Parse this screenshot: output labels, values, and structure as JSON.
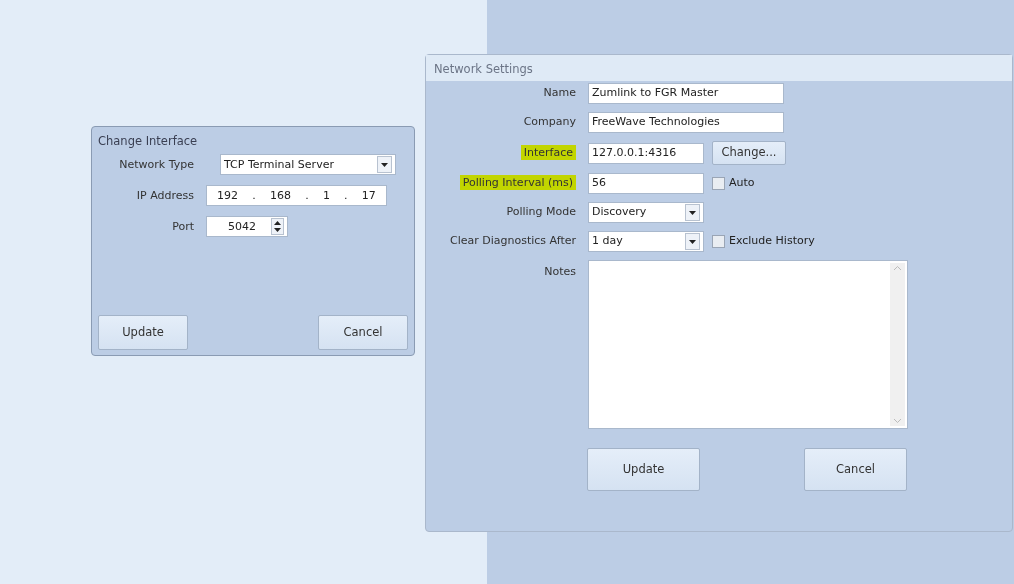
{
  "change_interface": {
    "title": "Change Interface",
    "fields": [
      {
        "kind": "select",
        "label": "Network Type",
        "value": "TCP Terminal Server"
      },
      {
        "kind": "ip",
        "label": "IP Address",
        "octets": [
          "192",
          "168",
          "1",
          "17"
        ],
        "separators": [
          ".",
          ".",
          "."
        ]
      },
      {
        "kind": "spin",
        "label": "Port",
        "value": "5042"
      }
    ],
    "buttons": [
      "Update",
      "Cancel"
    ]
  },
  "network_settings": {
    "title": "Network Settings",
    "fields": [
      {
        "kind": "text",
        "label": "Name",
        "highlighted": false,
        "value": "Zumlink to FGR Master"
      },
      {
        "kind": "text",
        "label": "Company",
        "highlighted": false,
        "value": "FreeWave Technologies"
      },
      {
        "kind": "text_button",
        "label": "Interface",
        "highlighted": true,
        "value": "127.0.0.1:4316",
        "button": "Change..."
      },
      {
        "kind": "text_checkbox",
        "label": "Polling Interval (ms)",
        "highlighted": true,
        "value": "56",
        "checkbox": {
          "label": "Auto",
          "checked": false
        }
      },
      {
        "kind": "select",
        "label": "Polling Mode",
        "highlighted": false,
        "value": "Discovery"
      },
      {
        "kind": "select_checkbox",
        "label": "Clear Diagnostics After",
        "highlighted": false,
        "value": "1 day",
        "checkbox": {
          "label": "Exclude History",
          "checked": false
        }
      },
      {
        "kind": "textarea",
        "label": "Notes",
        "highlighted": false
      }
    ],
    "buttons": [
      "Update",
      "Cancel"
    ]
  }
}
